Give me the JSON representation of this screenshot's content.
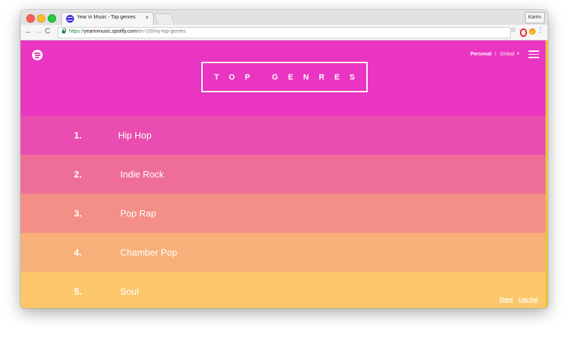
{
  "browser": {
    "tab_title": "Year in Music - Top genres",
    "tab_close": "×",
    "profile_name": "Karim",
    "url_scheme": "https://",
    "url_host": "yearinmusic.spotify.com",
    "url_path": "/en-US/my-top-genres",
    "back_glyph": "←",
    "forward_glyph": "→",
    "reload_glyph": "C",
    "star_glyph": "☆",
    "menu_glyph": "⋮"
  },
  "header": {
    "title": "TOP GENRES",
    "nav_personal": "Personal",
    "nav_separator": "|",
    "nav_global": "Global",
    "nav_caret": "▼"
  },
  "genres": [
    {
      "rank": "1.",
      "name": "Hip Hop",
      "color": "#e94daf"
    },
    {
      "rank": "2.",
      "name": "Indie Rock",
      "color": "#ef6e99"
    },
    {
      "rank": "3.",
      "name": "Pop Rap",
      "color": "#f38f86"
    },
    {
      "rank": "4.",
      "name": "Chamber Pop",
      "color": "#f7b07a"
    },
    {
      "rank": "5.",
      "name": "Soul",
      "color": "#fcc76a"
    }
  ],
  "footer": {
    "share": "Share",
    "logout": "Log Out"
  },
  "colors": {
    "header_bg": "#e935c1",
    "scroll_accent": "#f2c62e"
  },
  "icons": {
    "logo": "spotify-icon",
    "menu": "hamburger-menu-icon",
    "lock": "lock-icon",
    "bookmark": "star-icon"
  }
}
